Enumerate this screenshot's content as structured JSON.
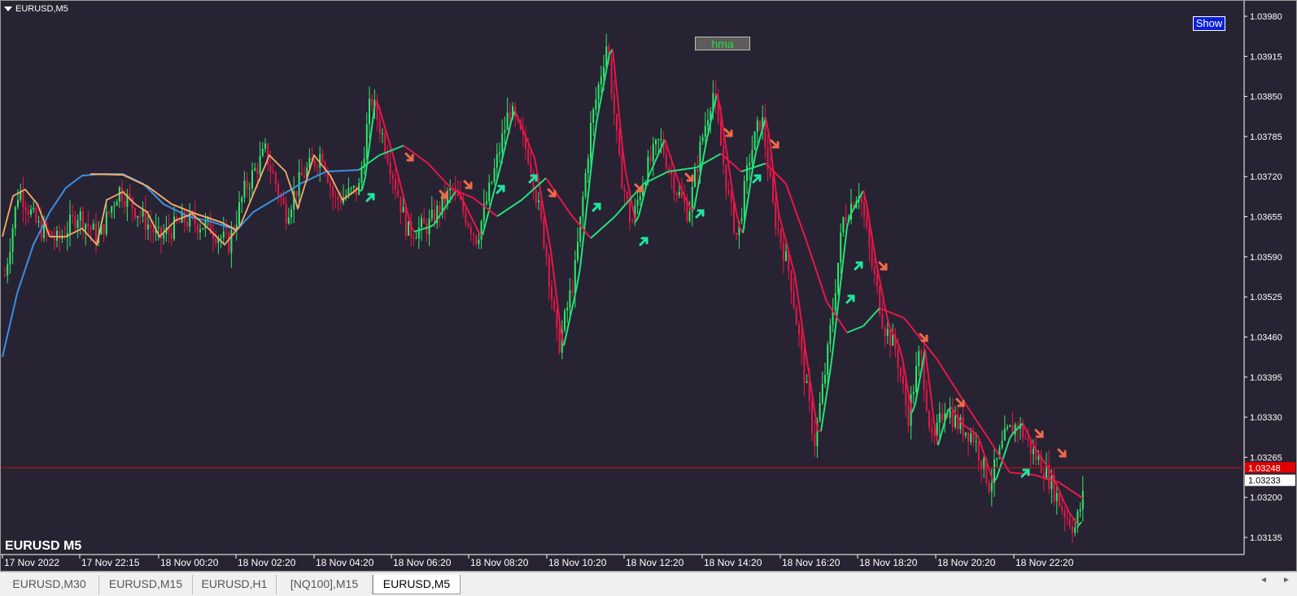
{
  "window": {
    "title": "EURUSD,M5",
    "symbol_label": "EURUSD M5"
  },
  "buttons": {
    "hma": "hma",
    "show": "Show"
  },
  "price_axis": {
    "ticks": [
      "1.03980",
      "1.03915",
      "1.03850",
      "1.03785",
      "1.03720",
      "1.03655",
      "1.03590",
      "1.03525",
      "1.03460",
      "1.03395",
      "1.03330",
      "1.03265",
      "1.03200",
      "1.03135"
    ],
    "bid_line_label": "1.03248",
    "last_price_label": "1.03233"
  },
  "time_axis": {
    "ticks": [
      "17 Nov 2022",
      "17 Nov 22:15",
      "18 Nov 00:20",
      "18 Nov 02:20",
      "18 Nov 04:20",
      "18 Nov 06:20",
      "18 Nov 08:20",
      "18 Nov 10:20",
      "18 Nov 12:20",
      "18 Nov 14:20",
      "18 Nov 16:20",
      "18 Nov 18:20",
      "18 Nov 20:20",
      "18 Nov 22:20"
    ]
  },
  "colors": {
    "background": "#282332",
    "bull": "#2ee86a",
    "bear": "#e8164a",
    "hma_up": "#22e27c",
    "hma_down": "#e8164a",
    "blue_ma": "#3a8fe6",
    "orange_ma": "#f0ac6a",
    "arrow_up": "#1fe8a0",
    "arrow_down": "#f06a4a",
    "bid_line": "#c81414"
  },
  "chart_data": {
    "type": "candlestick",
    "symbol": "EURUSD",
    "timeframe": "M5",
    "ylim": [
      1.031,
      1.0401
    ],
    "hma_series": [
      {
        "x": 0.28,
        "y": 1.0372
      },
      {
        "x": 0.31,
        "y": 1.0376
      },
      {
        "x": 0.34,
        "y": 1.0372
      },
      {
        "x": 0.37,
        "y": 1.03695
      },
      {
        "x": 0.4,
        "y": 1.03665
      },
      {
        "x": 0.43,
        "y": 1.0372
      },
      {
        "x": 0.47,
        "y": 1.0361
      },
      {
        "x": 0.5,
        "y": 1.0369
      },
      {
        "x": 0.53,
        "y": 1.0373
      },
      {
        "x": 0.56,
        "y": 1.0375
      },
      {
        "x": 0.59,
        "y": 1.03735
      },
      {
        "x": 0.62,
        "y": 1.0365
      },
      {
        "x": 0.65,
        "y": 1.0349
      },
      {
        "x": 0.68,
        "y": 1.0353
      },
      {
        "x": 0.71,
        "y": 1.03465
      },
      {
        "x": 0.74,
        "y": 1.03375
      },
      {
        "x": 0.77,
        "y": 1.0331
      },
      {
        "x": 0.8,
        "y": 1.0324
      },
      {
        "x": 0.83,
        "y": 1.0319
      }
    ]
  },
  "tabs": [
    {
      "label": "EURUSD,M30",
      "active": false
    },
    {
      "label": "EURUSD,M15",
      "active": false
    },
    {
      "label": "EURUSD,H1",
      "active": false
    },
    {
      "label": "[NQ100],M15",
      "active": false
    },
    {
      "label": "EURUSD,M5",
      "active": true
    }
  ]
}
